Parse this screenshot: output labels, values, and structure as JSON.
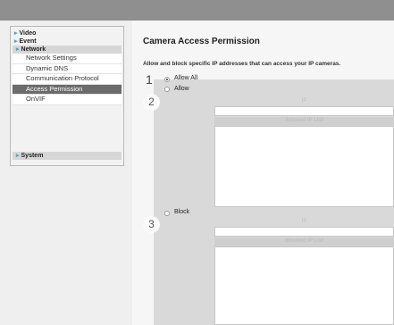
{
  "sidebar": {
    "video": "Video",
    "event": "Event",
    "network": "Network",
    "items": [
      {
        "label": "Network Settings"
      },
      {
        "label": "Dynamic DNS"
      },
      {
        "label": "Communication Protocol"
      },
      {
        "label": "Access Permission"
      },
      {
        "label": "OnVIF"
      }
    ],
    "system": "System",
    "arrow_glyph": "▸"
  },
  "main": {
    "title": "Camera Access Permission",
    "description": "Allow and block specific IP addresses that can access your IP cameras.",
    "allow_all_label": "Allow All",
    "allow_label": "Allow",
    "block_label": "Block",
    "ip_column": "IP",
    "allowed_list_title": "Allowed IP List",
    "blocked_list_title": "Blocked IP List",
    "selected_option": "Allow All"
  },
  "callouts": [
    "1",
    "2",
    "3"
  ],
  "colors": {
    "topbar": "#8f8f8f",
    "active_item": "#6b6b6b",
    "accent_arrow": "#5aa0c8"
  }
}
